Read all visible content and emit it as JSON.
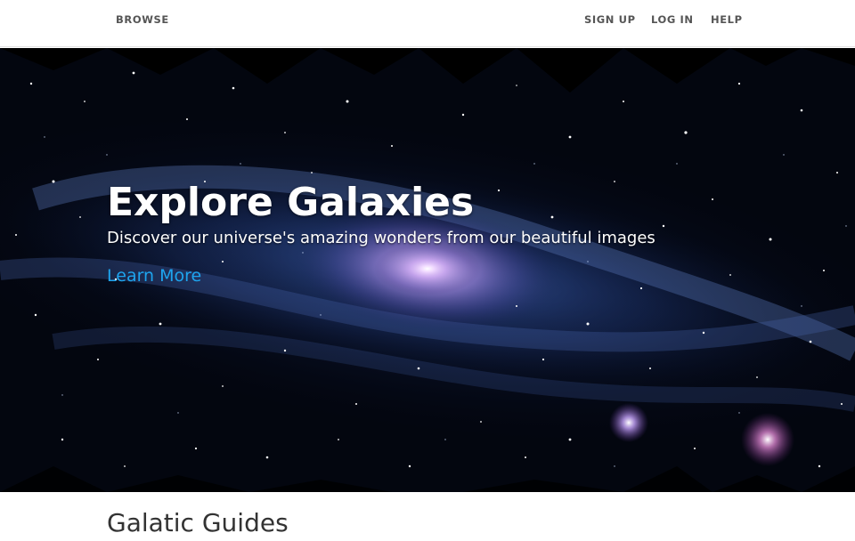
{
  "nav": {
    "browse": "BROWSE",
    "sign_up": "SIGN UP",
    "log_in": "LOG IN",
    "help": "HELP"
  },
  "hero": {
    "title": "Explore Galaxies",
    "subtitle": "Discover our universe's amazing wonders from our beautiful images",
    "link_label": "Learn More",
    "image": "galaxy-photo"
  },
  "section": {
    "title": "Galatic Guides"
  },
  "colors": {
    "link": "#1ea4ee",
    "nav_text": "#555555",
    "hero_text": "#ffffff",
    "section_title": "#333333"
  }
}
